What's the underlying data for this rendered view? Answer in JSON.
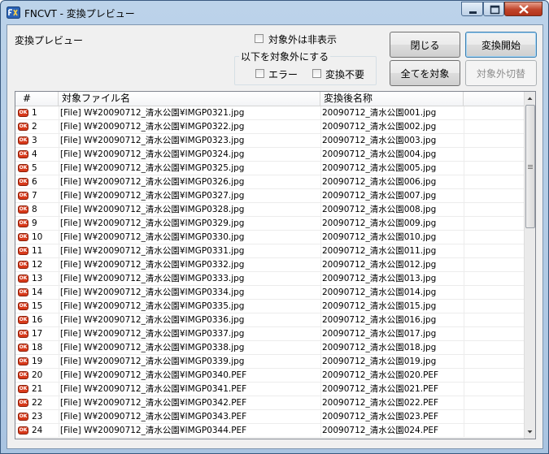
{
  "window": {
    "title": "FNCVT - 変換プレビュー",
    "icon": "fncvt-app-icon",
    "controls": [
      "minimize-icon",
      "maximize-icon",
      "close-icon"
    ]
  },
  "top": {
    "preview_label": "変換プレビュー",
    "hide_excluded_label": "対象外は非表示",
    "exclude_group_label": "以下を対象外にする",
    "error_label": "エラー",
    "no_convert_label": "変換不要"
  },
  "buttons": {
    "close": "閉じる",
    "start": "変換開始",
    "all_target": "全てを対象",
    "toggle_excluded": "対象外切替"
  },
  "table": {
    "columns": [
      "#",
      "対象ファイル名",
      "変換後名称"
    ],
    "status_icon": "ok-badge-icon",
    "rows": [
      {
        "num": "1",
        "src": "[File] W¥20090712_清水公園¥IMGP0321.jpg",
        "dst": "20090712_清水公園001.jpg"
      },
      {
        "num": "2",
        "src": "[File] W¥20090712_清水公園¥IMGP0322.jpg",
        "dst": "20090712_清水公園002.jpg"
      },
      {
        "num": "3",
        "src": "[File] W¥20090712_清水公園¥IMGP0323.jpg",
        "dst": "20090712_清水公園003.jpg"
      },
      {
        "num": "4",
        "src": "[File] W¥20090712_清水公園¥IMGP0324.jpg",
        "dst": "20090712_清水公園004.jpg"
      },
      {
        "num": "5",
        "src": "[File] W¥20090712_清水公園¥IMGP0325.jpg",
        "dst": "20090712_清水公園005.jpg"
      },
      {
        "num": "6",
        "src": "[File] W¥20090712_清水公園¥IMGP0326.jpg",
        "dst": "20090712_清水公園006.jpg"
      },
      {
        "num": "7",
        "src": "[File] W¥20090712_清水公園¥IMGP0327.jpg",
        "dst": "20090712_清水公園007.jpg"
      },
      {
        "num": "8",
        "src": "[File] W¥20090712_清水公園¥IMGP0328.jpg",
        "dst": "20090712_清水公園008.jpg"
      },
      {
        "num": "9",
        "src": "[File] W¥20090712_清水公園¥IMGP0329.jpg",
        "dst": "20090712_清水公園009.jpg"
      },
      {
        "num": "10",
        "src": "[File] W¥20090712_清水公園¥IMGP0330.jpg",
        "dst": "20090712_清水公園010.jpg"
      },
      {
        "num": "11",
        "src": "[File] W¥20090712_清水公園¥IMGP0331.jpg",
        "dst": "20090712_清水公園011.jpg"
      },
      {
        "num": "12",
        "src": "[File] W¥20090712_清水公園¥IMGP0332.jpg",
        "dst": "20090712_清水公園012.jpg"
      },
      {
        "num": "13",
        "src": "[File] W¥20090712_清水公園¥IMGP0333.jpg",
        "dst": "20090712_清水公園013.jpg"
      },
      {
        "num": "14",
        "src": "[File] W¥20090712_清水公園¥IMGP0334.jpg",
        "dst": "20090712_清水公園014.jpg"
      },
      {
        "num": "15",
        "src": "[File] W¥20090712_清水公園¥IMGP0335.jpg",
        "dst": "20090712_清水公園015.jpg"
      },
      {
        "num": "16",
        "src": "[File] W¥20090712_清水公園¥IMGP0336.jpg",
        "dst": "20090712_清水公園016.jpg"
      },
      {
        "num": "17",
        "src": "[File] W¥20090712_清水公園¥IMGP0337.jpg",
        "dst": "20090712_清水公園017.jpg"
      },
      {
        "num": "18",
        "src": "[File] W¥20090712_清水公園¥IMGP0338.jpg",
        "dst": "20090712_清水公園018.jpg"
      },
      {
        "num": "19",
        "src": "[File] W¥20090712_清水公園¥IMGP0339.jpg",
        "dst": "20090712_清水公園019.jpg"
      },
      {
        "num": "20",
        "src": "[File] W¥20090712_清水公園¥IMGP0340.PEF",
        "dst": "20090712_清水公園020.PEF"
      },
      {
        "num": "21",
        "src": "[File] W¥20090712_清水公園¥IMGP0341.PEF",
        "dst": "20090712_清水公園021.PEF"
      },
      {
        "num": "22",
        "src": "[File] W¥20090712_清水公園¥IMGP0342.PEF",
        "dst": "20090712_清水公園022.PEF"
      },
      {
        "num": "23",
        "src": "[File] W¥20090712_清水公園¥IMGP0343.PEF",
        "dst": "20090712_清水公園023.PEF"
      },
      {
        "num": "24",
        "src": "[File] W¥20090712_清水公園¥IMGP0344.PEF",
        "dst": "20090712_清水公園024.PEF"
      }
    ]
  },
  "colors": {
    "ok_badge": "#d8391a",
    "window_frame": "#a9c4e1"
  }
}
